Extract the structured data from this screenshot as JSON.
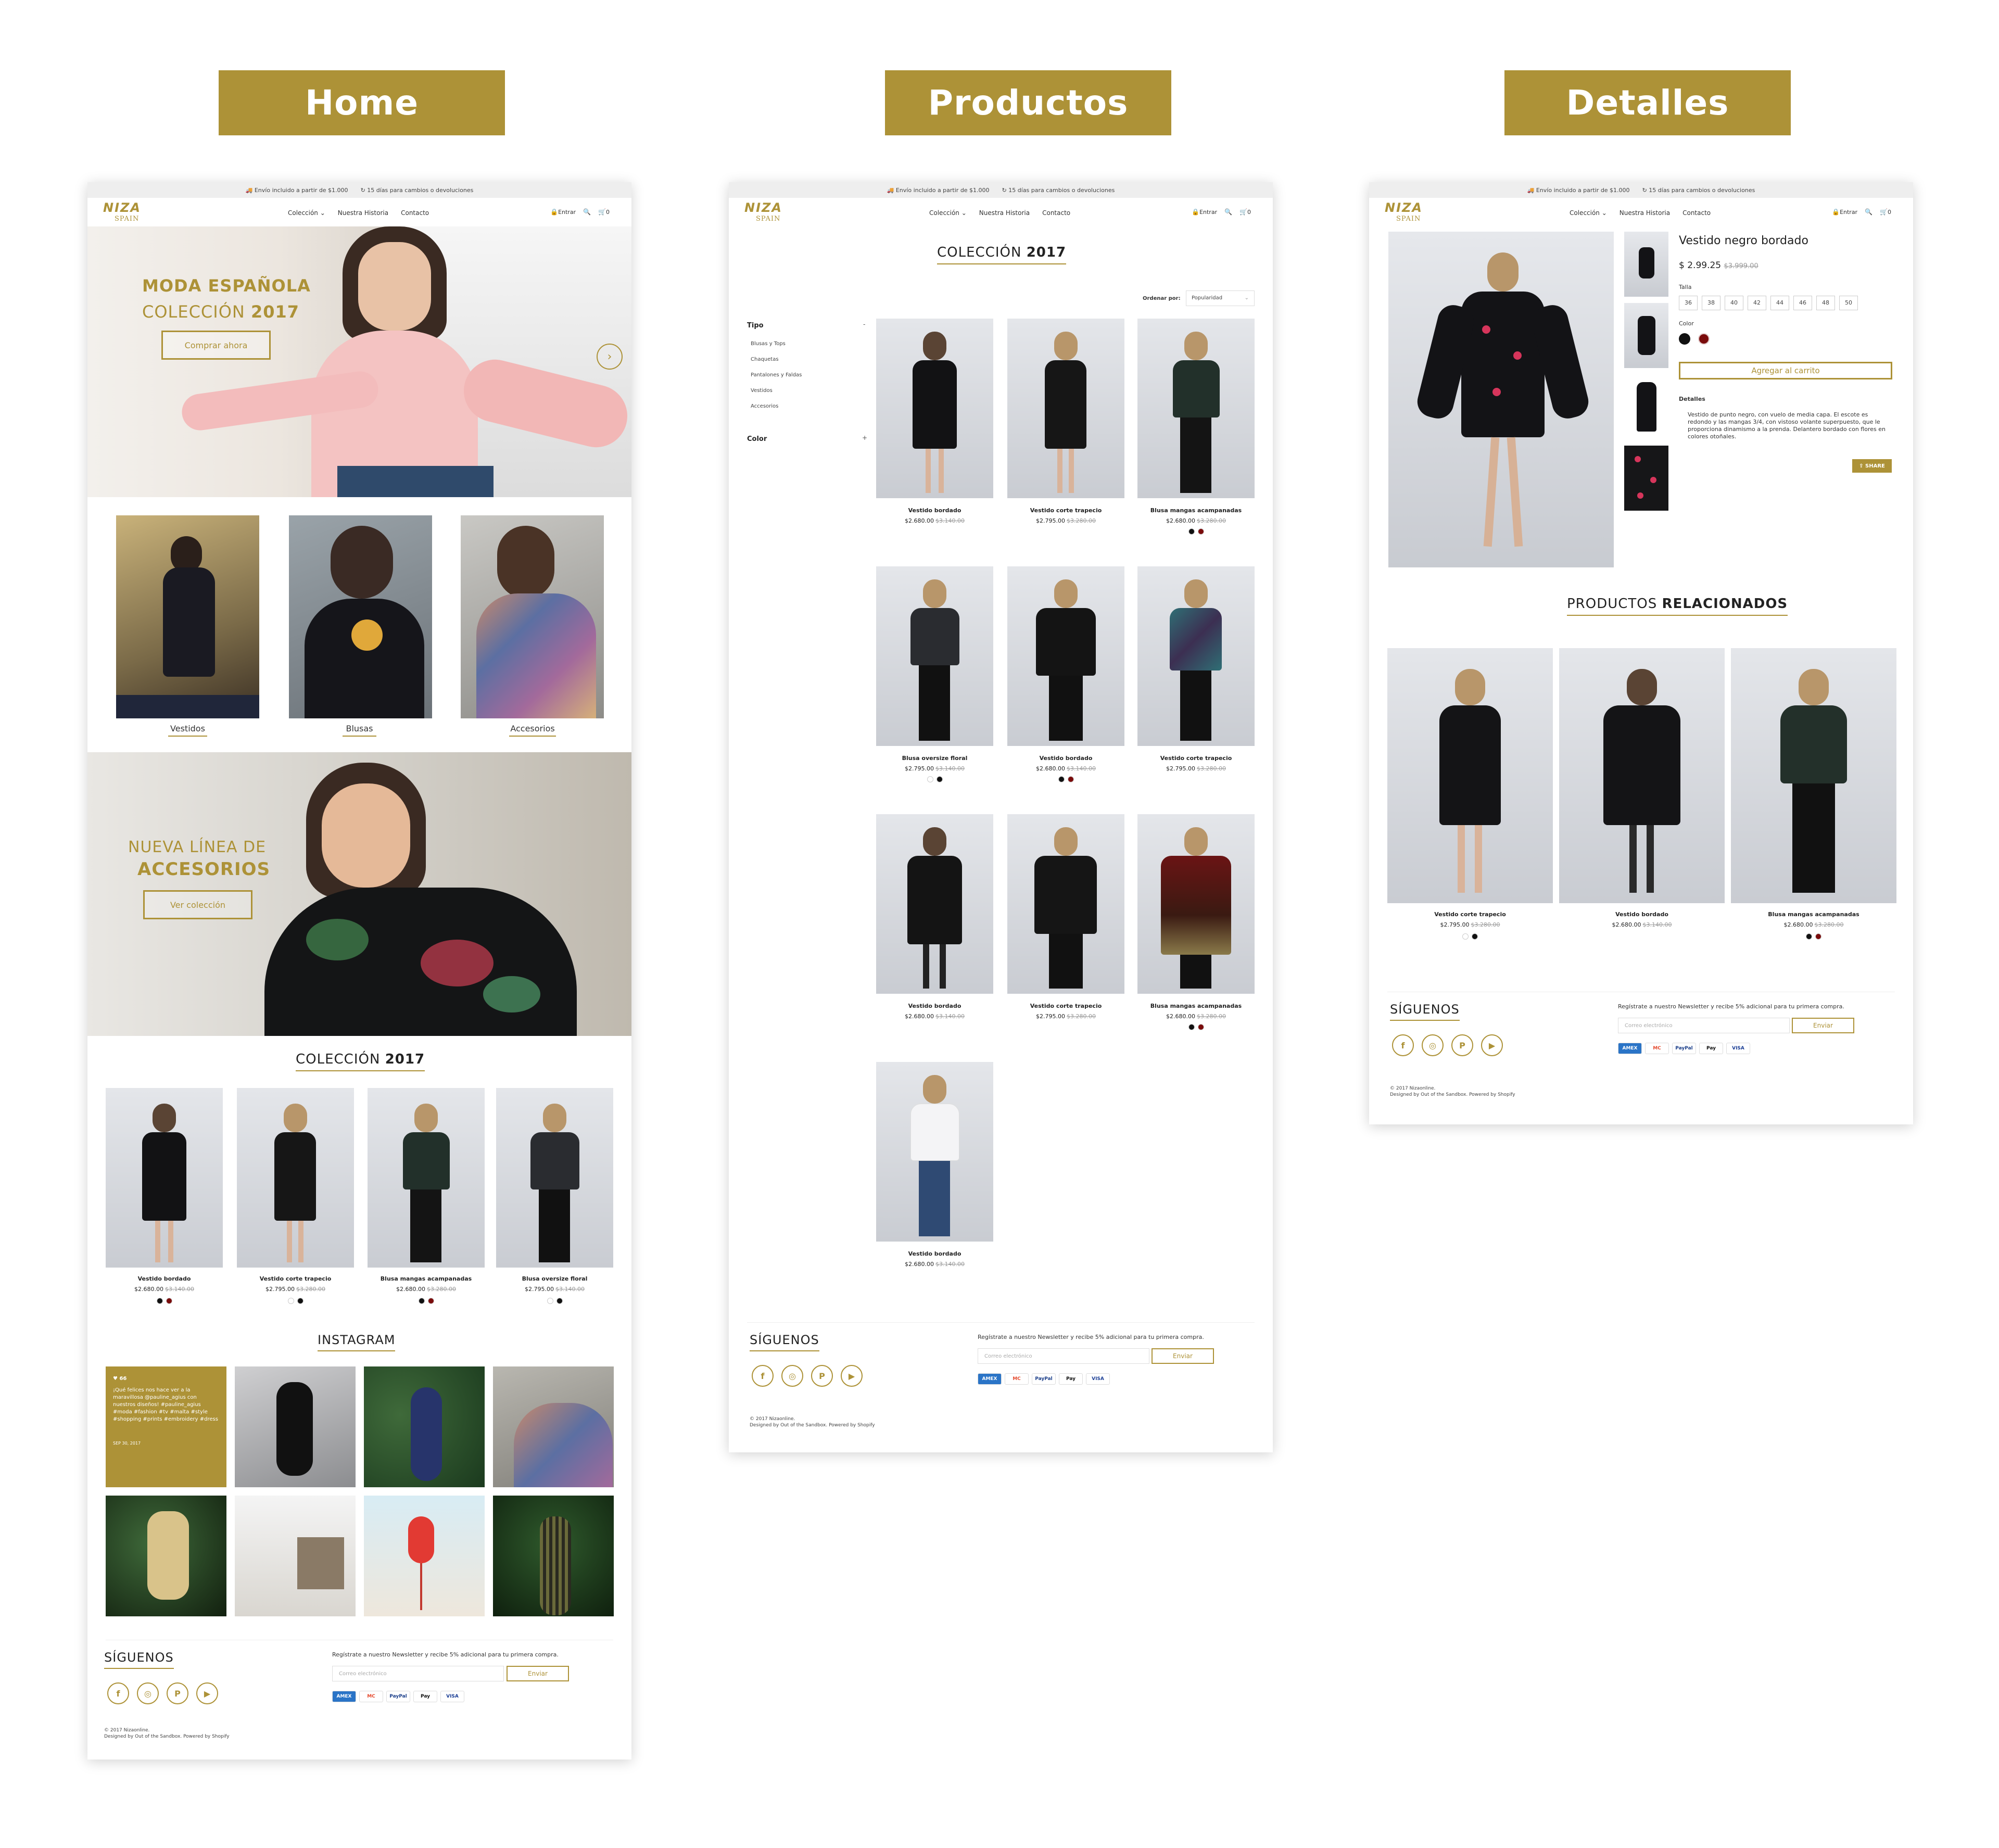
{
  "banners": {
    "home": "Home",
    "productos": "Productos",
    "detalles": "Detalles"
  },
  "topbar": {
    "shipping": "Envío incluido a partir de $1.000",
    "returns": "15 días para cambios o devoluciones"
  },
  "nav": {
    "logo": "NIZA",
    "logo_sub": "SPAIN",
    "menu": [
      "Colección ⌄",
      "Nuestra Historia",
      "Contacto"
    ],
    "login": "Entrar",
    "cart_count": "0"
  },
  "home": {
    "hero": {
      "line1": "MODA ESPAÑOLA",
      "line2_a": "COLECCIÓN",
      "line2_b": "2017",
      "cta": "Comprar ahora"
    },
    "categories": [
      "Vestidos",
      "Blusas",
      "Accesorios"
    ],
    "promo": {
      "line1": "NUEVA LÍNEA DE",
      "line2": "ACCESORIOS",
      "cta": "Ver colección"
    },
    "collection": {
      "title_a": "COLECCIÓN",
      "title_b": "2017"
    },
    "products": [
      {
        "name": "Vestido bordado",
        "price": "$2.680.00",
        "old": "$3.140.00"
      },
      {
        "name": "Vestido corte trapecio",
        "price": "$2.795.00",
        "old": "$3.280.00"
      },
      {
        "name": "Blusa mangas acampanadas",
        "price": "$2.680.00",
        "old": "$3.280.00"
      },
      {
        "name": "Blusa oversize floral",
        "price": "$2.795.00",
        "old": "$3.140.00"
      }
    ],
    "instagram": {
      "title": "INSTAGRAM",
      "likes": "66",
      "caption": "¡Qué felices nos hace ver a la maravillosa @pauline_agius con nuestros diseños! #pauline_agius #moda #fashion #tv #malta #style #shopping #prints #embroidery #dress",
      "date": "SEP 30, 2017"
    }
  },
  "productos": {
    "title_a": "COLECCIÓN",
    "title_b": "2017",
    "sort_label": "Ordenar por:",
    "sort_value": "Popularidad",
    "filter_tipo": "Tipo",
    "filter_items": [
      "Blusas y Tops",
      "Chaquetas",
      "Pantalones y Faldas",
      "Vestidos",
      "Accesorios"
    ],
    "filter_color": "Color",
    "products": [
      {
        "name": "Vestido bordado",
        "price": "$2.680.00",
        "old": "$3.140.00"
      },
      {
        "name": "Vestido corte trapecio",
        "price": "$2.795.00",
        "old": "$3.280.00"
      },
      {
        "name": "Blusa mangas acampanadas",
        "price": "$2.680.00",
        "old": "$3.280.00"
      },
      {
        "name": "Blusa oversize floral",
        "price": "$2.795.00",
        "old": "$3.140.00"
      },
      {
        "name": "Vestido bordado",
        "price": "$2.680.00",
        "old": "$3.140.00"
      },
      {
        "name": "Vestido corte trapecio",
        "price": "$2.795.00",
        "old": "$3.280.00"
      },
      {
        "name": "Vestido bordado",
        "price": "$2.680.00",
        "old": "$3.140.00"
      },
      {
        "name": "Vestido corte trapecio",
        "price": "$2.795.00",
        "old": "$3.280.00"
      },
      {
        "name": "Blusa mangas acampanadas",
        "price": "$2.680.00",
        "old": "$3.280.00"
      },
      {
        "name": "Vestido bordado",
        "price": "$2.680.00",
        "old": "$3.140.00"
      }
    ]
  },
  "detalles": {
    "name": "Vestido negro bordado",
    "price": "$ 2.99.25",
    "old": "$3.999.00",
    "size_label": "Talla",
    "sizes": [
      "36",
      "38",
      "40",
      "42",
      "44",
      "46",
      "48",
      "50"
    ],
    "color_label": "Color",
    "add_to_cart": "Agregar al carrito",
    "details_label": "Detalles",
    "description": "Vestido de punto negro, con vuelo de media capa. El escote es redondo y las mangas 3/4, con vistoso volante superpuesto, que le proporciona dinamismo a la prenda. Delantero bordado con flores en colores otoñales.",
    "share": "SHARE",
    "related_a": "PRODUCTOS",
    "related_b": "RELACIONADOS",
    "related": [
      {
        "name": "Vestido corte trapecio",
        "price": "$2.795.00",
        "old": "$3.280.00"
      },
      {
        "name": "Vestido bordado",
        "price": "$2.680.00",
        "old": "$3.140.00"
      },
      {
        "name": "Blusa mangas acampanadas",
        "price": "$2.680.00",
        "old": "$3.280.00"
      }
    ]
  },
  "footer": {
    "follow": "SÍGUENOS",
    "newsletter": "Regístrate a nuestro Newsletter y recibe 5% adicional para tu primera compra.",
    "email_placeholder": "Correo electrónico",
    "send": "Enviar",
    "payments": [
      "AMEX",
      "MC",
      "PayPal",
      "Pay",
      "VISA"
    ],
    "copyright": "© 2017 Nizaonline.",
    "credits": "Designed by Out of the Sandbox. Powered by Shopify"
  },
  "colors": {
    "gold": "#ad9237",
    "black": "#111111",
    "red": "#7a0b0b"
  }
}
